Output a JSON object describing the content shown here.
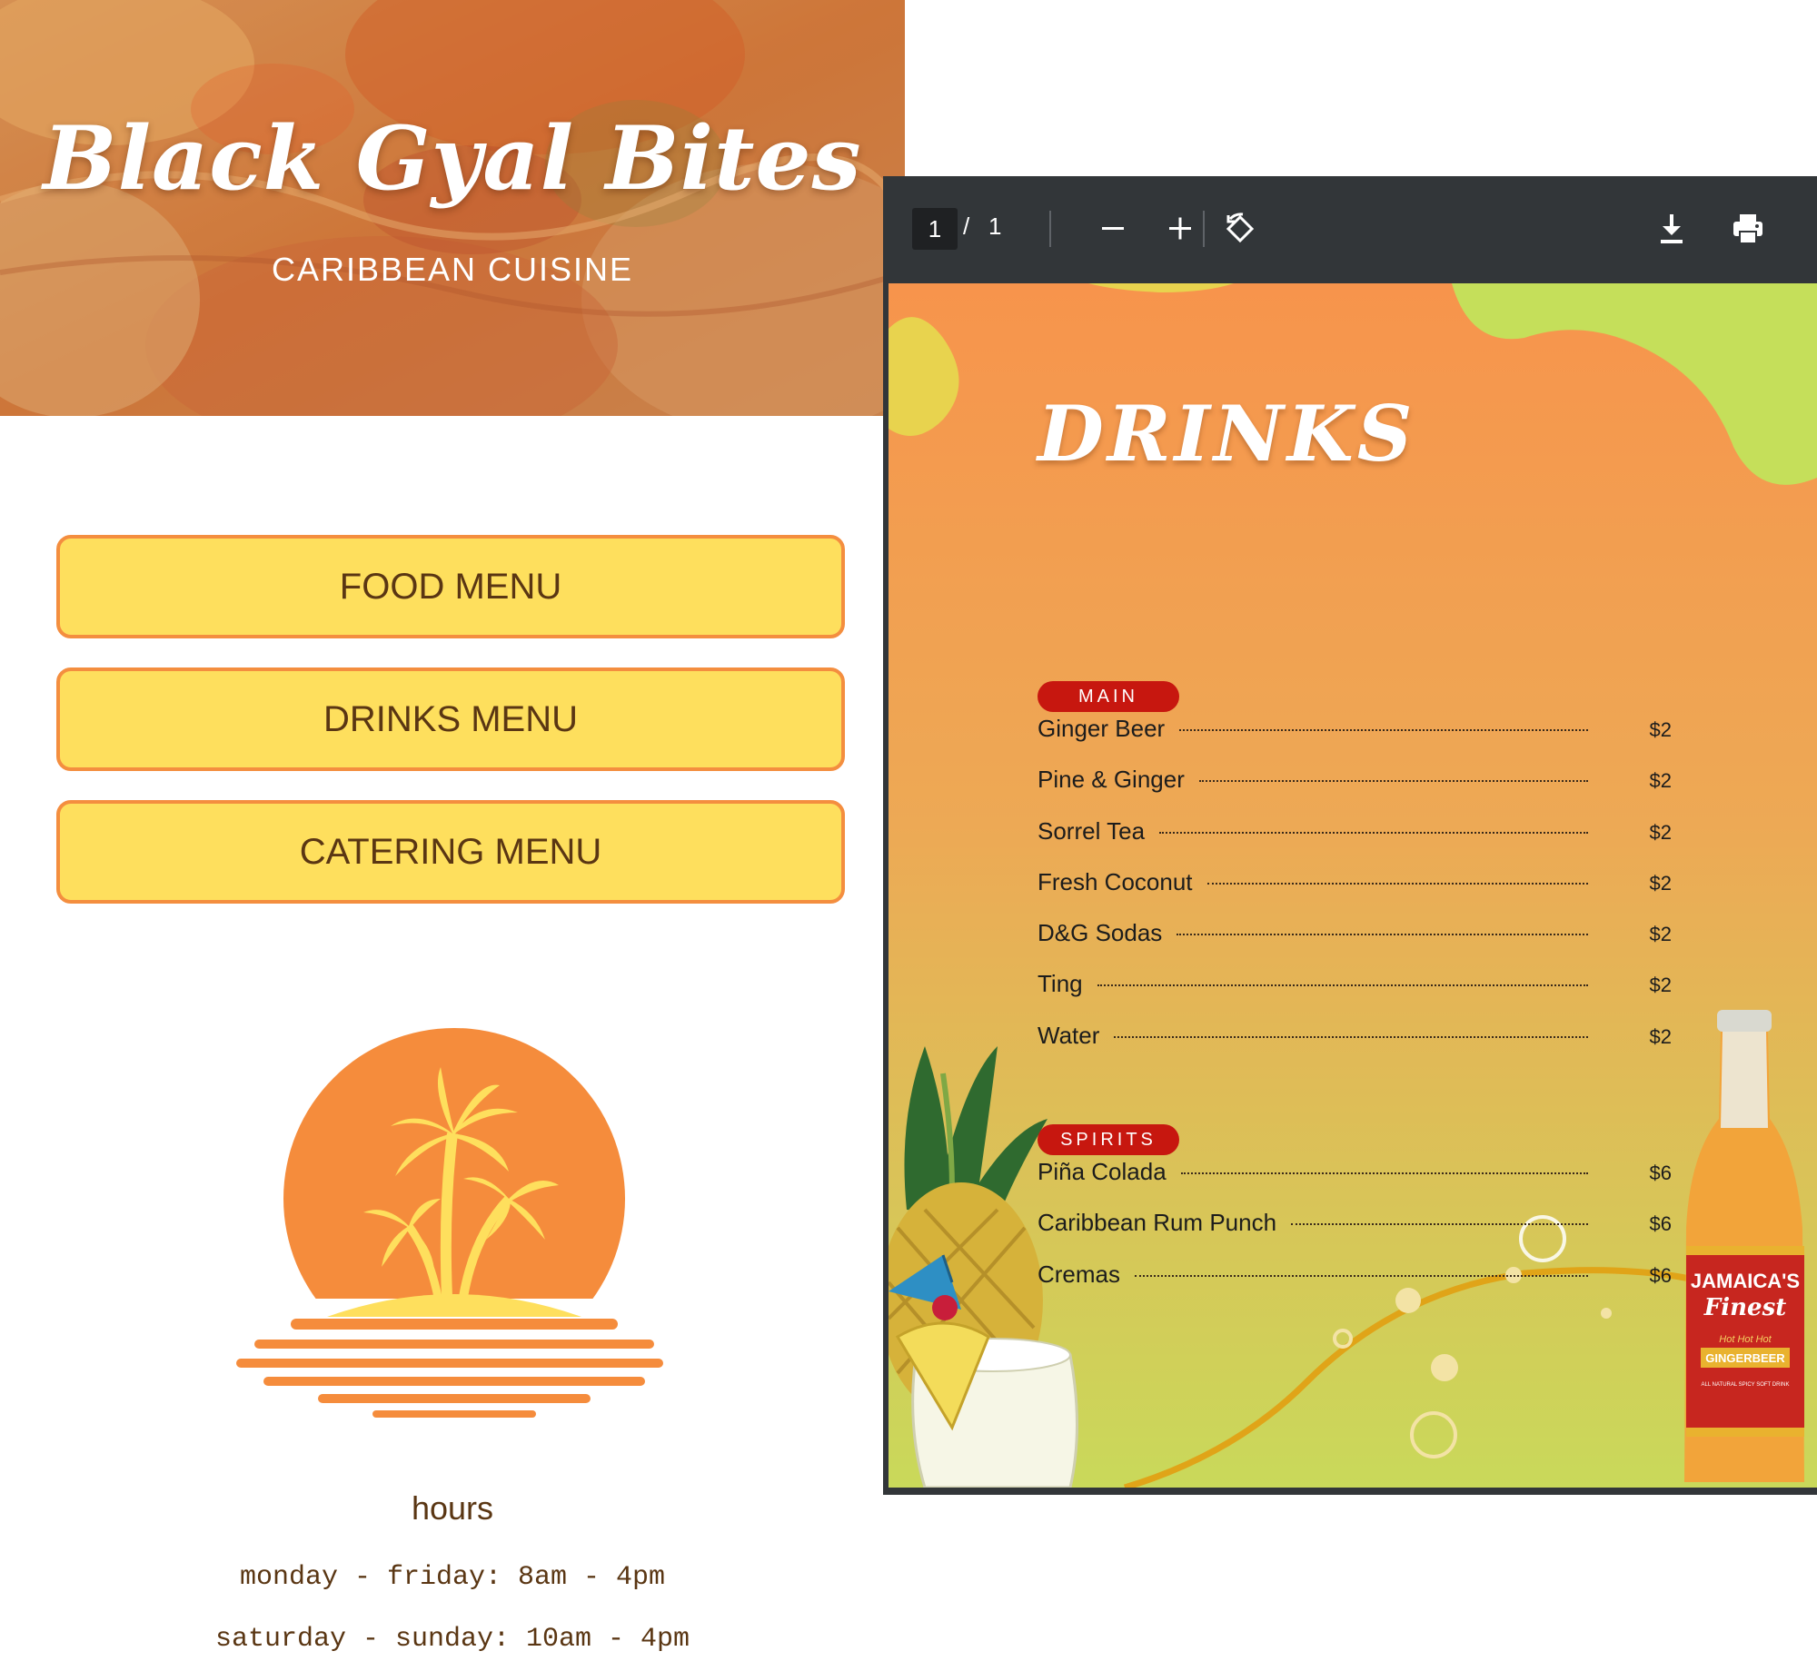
{
  "site": {
    "title": "Black Gyal Bites",
    "subtitle": "CARIBBEAN CUISINE",
    "buttons": {
      "food": "FOOD MENU",
      "drinks": "DRINKS MENU",
      "catering": "CATERING MENU"
    },
    "logo_icon": "sunset-palm-island-icon",
    "hours": {
      "title": "hours",
      "weekdays": "monday - friday: 8am - 4pm",
      "weekend": "saturday - sunday: 10am - 4pm"
    },
    "colors": {
      "button_fill": "#fedf5d",
      "button_border": "#f48e3f",
      "text_brown": "#5a3613",
      "logo_orange": "#f58c3c",
      "logo_yellow": "#fedf5d"
    }
  },
  "viewer": {
    "page_current": "1",
    "page_separator": "/",
    "page_total": "1",
    "toolbar_icons": [
      "zoom-out-icon",
      "zoom-in-icon",
      "rotate-icon",
      "download-icon",
      "print-icon",
      "more-options-icon"
    ],
    "document": {
      "title": "DRINKS",
      "sections": [
        {
          "name": "MAIN",
          "items": [
            {
              "name": "Ginger Beer",
              "price": "$2"
            },
            {
              "name": "Pine & Ginger",
              "price": "$2"
            },
            {
              "name": "Sorrel Tea",
              "price": "$2"
            },
            {
              "name": "Fresh Coconut",
              "price": "$2"
            },
            {
              "name": "D&G Sodas",
              "price": "$2"
            },
            {
              "name": "Ting",
              "price": "$2"
            },
            {
              "name": "Water",
              "price": "$2"
            }
          ]
        },
        {
          "name": "SPIRITS",
          "items": [
            {
              "name": "Piña Colada",
              "price": "$6"
            },
            {
              "name": "Caribbean Rum Punch",
              "price": "$6"
            },
            {
              "name": "Cremas",
              "price": "$6"
            }
          ]
        }
      ],
      "bottle_label": {
        "brand": "JAMAICA'S",
        "script": "Finest",
        "tagline": "Hot Hot Hot",
        "product": "GINGERBEER",
        "fineprint": "ALL NATURAL SPICY SOFT DRINK"
      },
      "colors": {
        "pill": "#c7170f",
        "bg_top": "#f7944c",
        "bg_bottom": "#c9d95a",
        "lime": "#c5df5a"
      }
    }
  }
}
